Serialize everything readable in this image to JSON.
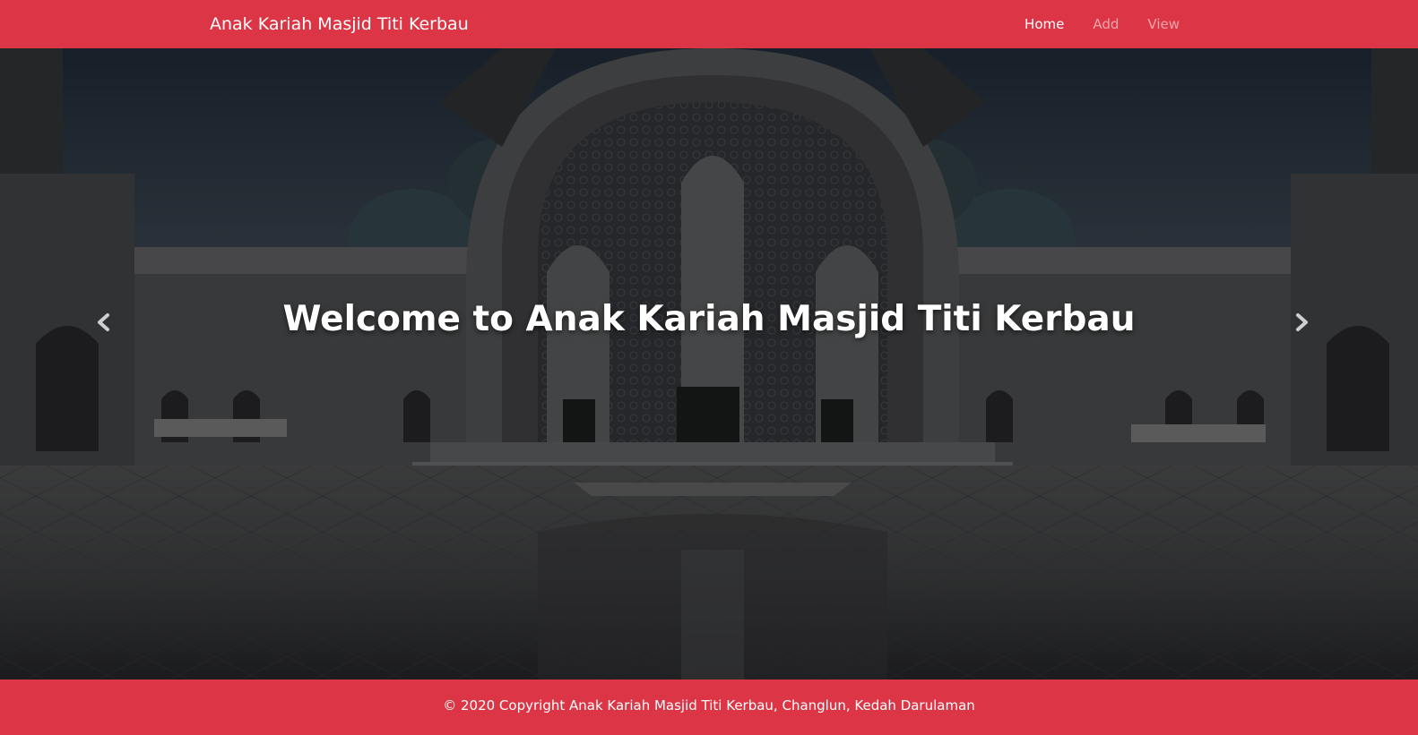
{
  "navbar": {
    "brand": "Anak Kariah Masjid Titi Kerbau",
    "links": [
      {
        "label": "Home",
        "active": true
      },
      {
        "label": "Add",
        "active": false
      },
      {
        "label": "View",
        "active": false
      }
    ]
  },
  "hero": {
    "title": "Welcome to Anak Kariah Masjid Titi Kerbau",
    "prev_icon": "chevron-left-icon",
    "next_icon": "chevron-right-icon"
  },
  "footer": {
    "text": "© 2020 Copyright Anak Kariah Masjid Titi Kerbau, Changlun, Kedah Darulaman"
  },
  "colors": {
    "brand_red": "#dc3545",
    "nav_inactive": "rgba(255,255,255,0.55)"
  }
}
